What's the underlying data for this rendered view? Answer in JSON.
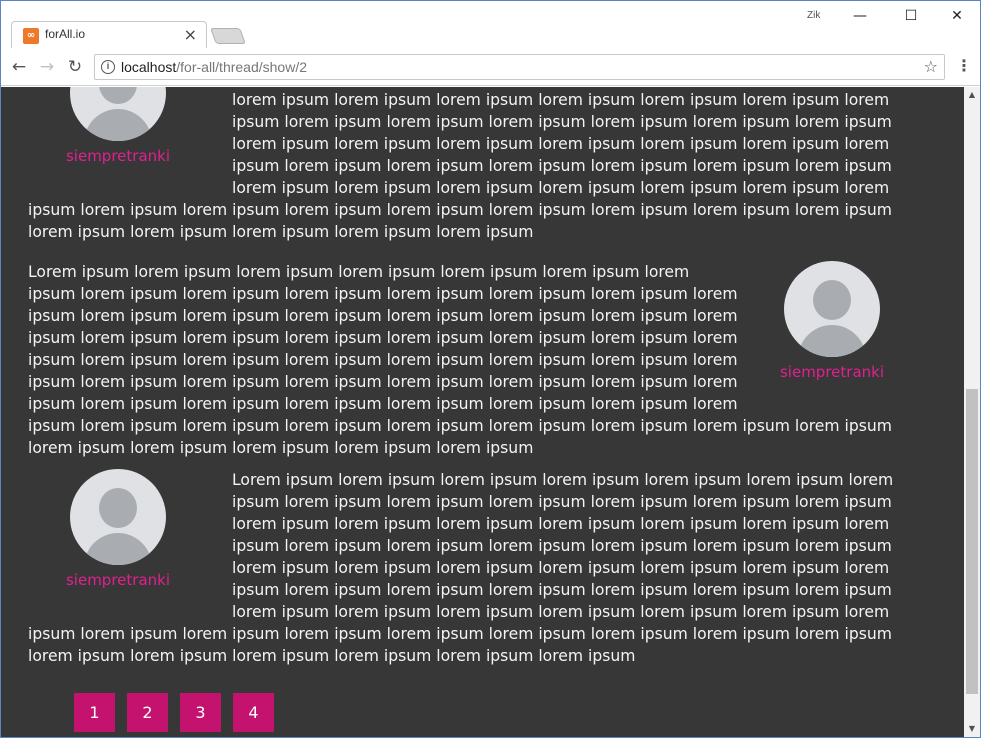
{
  "browser": {
    "tab_title": "forAll.io",
    "tab_close": "×",
    "favicon_letter": "∞",
    "url_host": "localhost",
    "url_path": "/for-all/thread/show/2",
    "profile_label": "Zik",
    "win_minimize": "—",
    "win_maximize": "☐",
    "win_close": "✕",
    "back": "←",
    "forward": "→",
    "reload": "↻",
    "info": "i",
    "star": "☆",
    "menu": "⋮"
  },
  "posts": [
    {
      "author": "siempretranki",
      "side": "left",
      "text": "lorem ipsum lorem ipsum lorem ipsum lorem ipsum lorem ipsum lorem ipsum lorem ipsum lorem ipsum lorem ipsum lorem ipsum lorem ipsum lorem ipsum lorem ipsum lorem ipsum lorem ipsum lorem ipsum lorem ipsum lorem ipsum lorem ipsum lorem ipsum lorem ipsum lorem ipsum lorem ipsum lorem ipsum lorem ipsum lorem ipsum lorem ipsum lorem ipsum lorem ipsum lorem ipsum lorem ipsum lorem ipsum lorem ipsum lorem ipsum lorem ipsum lorem ipsum lorem ipsum lorem ipsum lorem ipsum lorem ipsum lorem ipsum lorem ipsum lorem ipsum lorem ipsum lorem ipsum lorem ipsum lorem ipsum lorem ipsum lorem ipsum lorem ipsum lorem ipsum lorem ipsum lorem ipsum lorem ipsum lorem ipsum lorem ipsum lorem ipsum lorem ipsum lorem ipsum"
    },
    {
      "author": "siempretranki",
      "side": "right",
      "text": "Lorem ipsum lorem ipsum lorem ipsum lorem ipsum lorem ipsum lorem ipsum lorem ipsum lorem ipsum lorem ipsum lorem ipsum lorem ipsum lorem ipsum lorem ipsum lorem ipsum lorem ipsum lorem ipsum lorem ipsum lorem ipsum lorem ipsum lorem ipsum lorem ipsum lorem ipsum lorem ipsum lorem ipsum lorem ipsum lorem ipsum lorem ipsum lorem ipsum lorem ipsum lorem ipsum lorem ipsum lorem ipsum lorem ipsum lorem ipsum lorem ipsum lorem ipsum lorem ipsum lorem ipsum lorem ipsum lorem ipsum lorem ipsum lorem ipsum lorem ipsum lorem ipsum lorem ipsum lorem ipsum lorem ipsum lorem ipsum lorem ipsum lorem ipsum lorem ipsum lorem ipsum lorem ipsum lorem ipsum lorem ipsum lorem ipsum lorem ipsum lorem ipsum lorem ipsum lorem ipsum lorem ipsum lorem ipsum"
    },
    {
      "author": "siempretranki",
      "side": "left",
      "text": "Lorem ipsum lorem ipsum lorem ipsum lorem ipsum lorem ipsum lorem ipsum lorem ipsum lorem ipsum lorem ipsum lorem ipsum lorem ipsum lorem ipsum lorem ipsum lorem ipsum lorem ipsum lorem ipsum lorem ipsum lorem ipsum lorem ipsum lorem ipsum lorem ipsum lorem ipsum lorem ipsum lorem ipsum lorem ipsum lorem ipsum lorem ipsum lorem ipsum lorem ipsum lorem ipsum lorem ipsum lorem ipsum lorem ipsum lorem ipsum lorem ipsum lorem ipsum lorem ipsum lorem ipsum lorem ipsum lorem ipsum lorem ipsum lorem ipsum lorem ipsum lorem ipsum lorem ipsum lorem ipsum lorem ipsum lorem ipsum lorem ipsum lorem ipsum lorem ipsum lorem ipsum lorem ipsum lorem ipsum lorem ipsum lorem ipsum lorem ipsum lorem ipsum lorem ipsum lorem ipsum"
    }
  ],
  "pagination": [
    "1",
    "2",
    "3",
    "4"
  ],
  "colors": {
    "page_bg": "#373737",
    "author_name": "#e0208f",
    "pager_bg": "#c4126f"
  }
}
